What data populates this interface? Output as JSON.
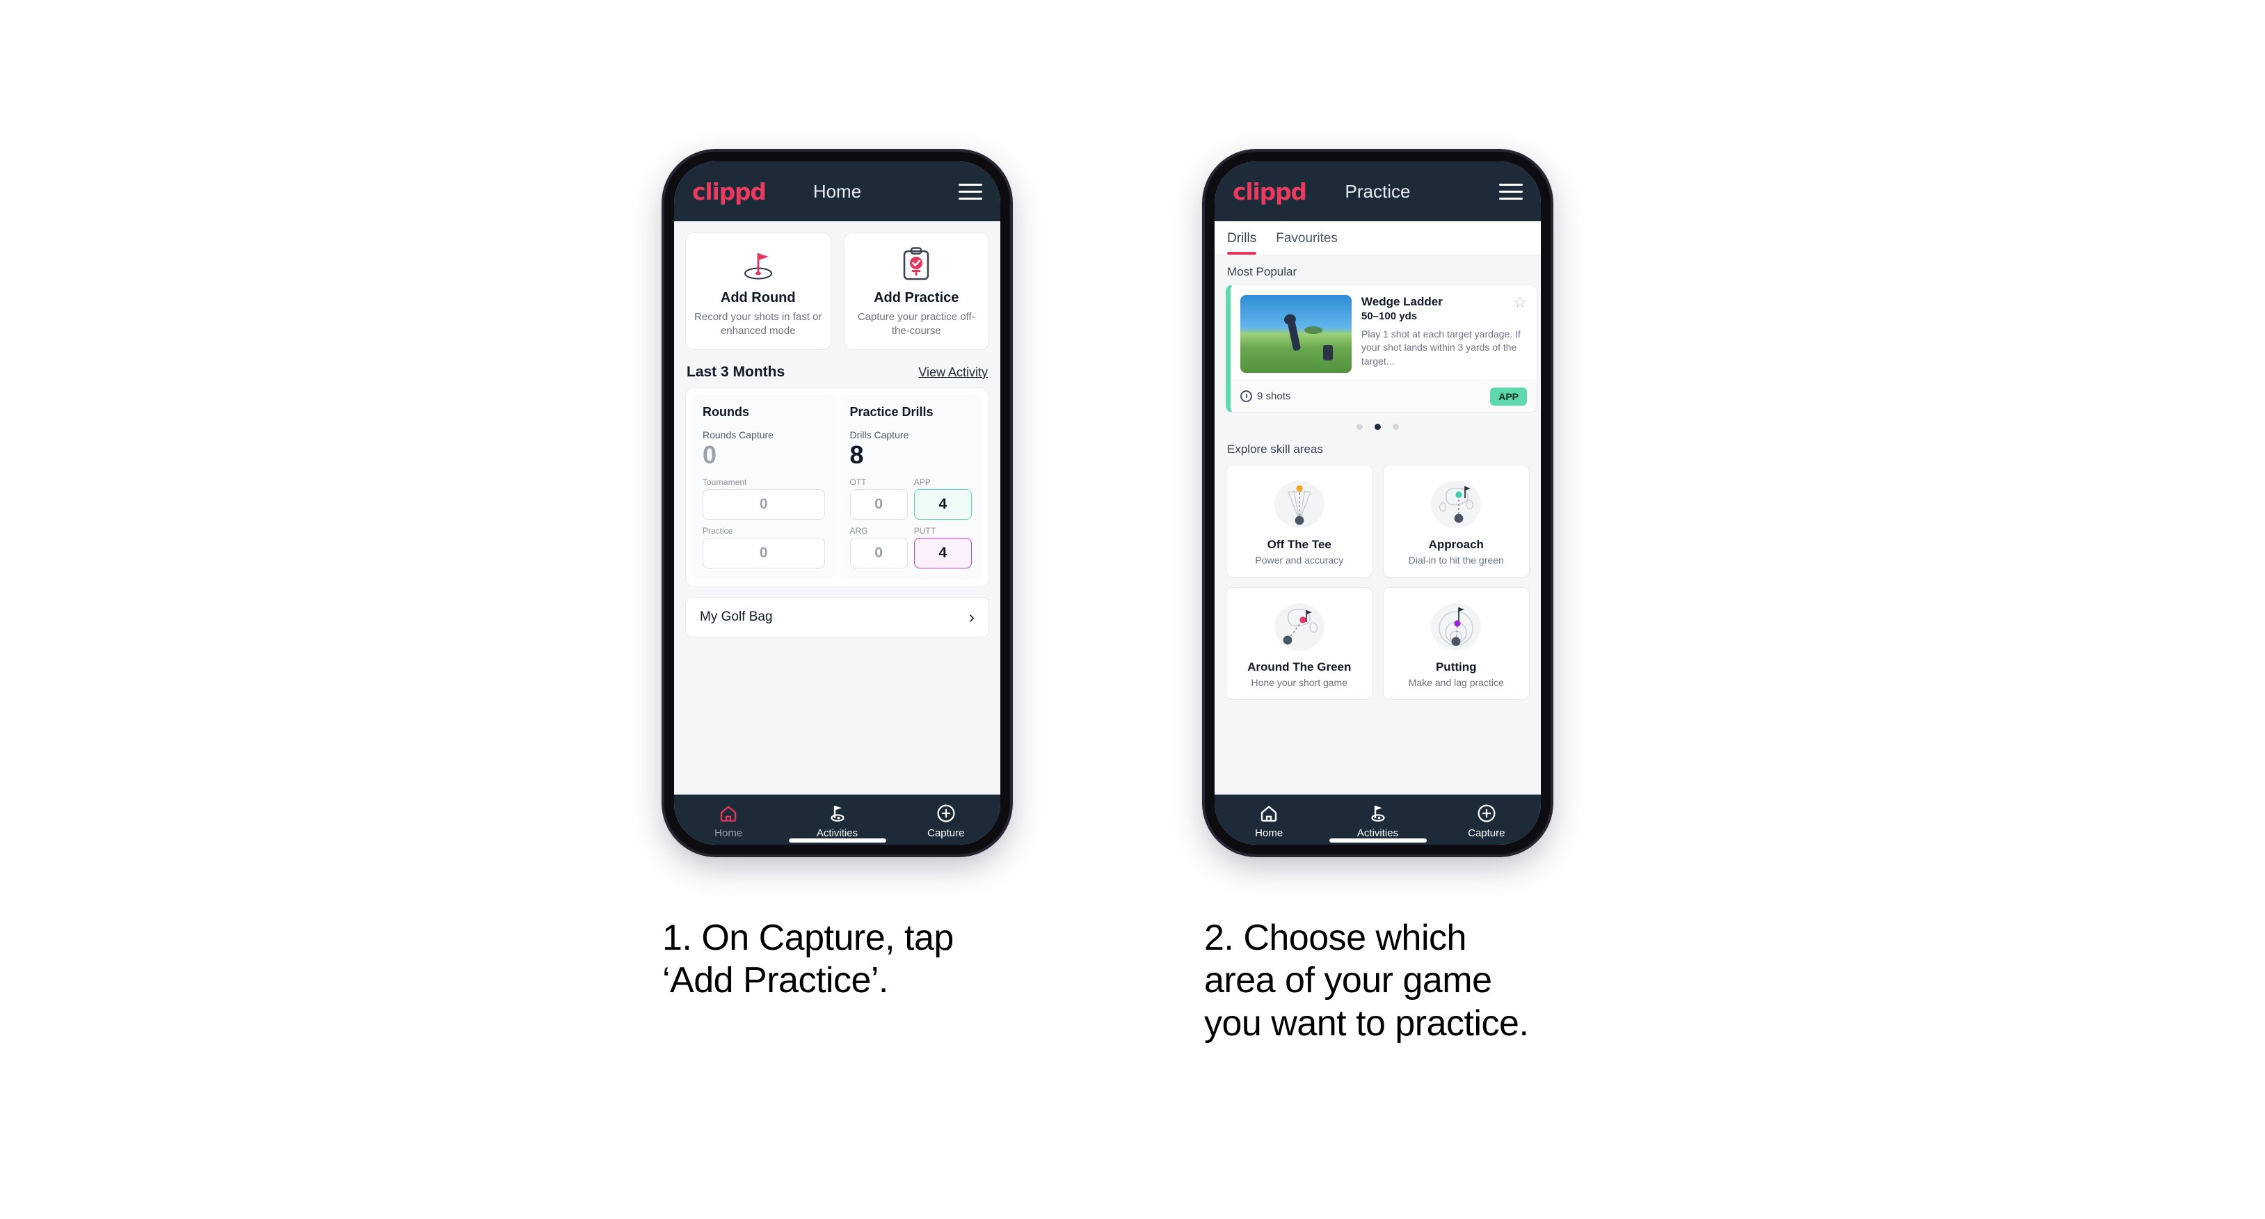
{
  "phones": [
    {
      "header": {
        "logo": "clippd",
        "title": "Home",
        "menu_icon": "hamburger-icon"
      },
      "actions": [
        {
          "icon": "golf-flag-hole-icon",
          "title": "Add Round",
          "desc": "Record your shots in fast or enhanced mode"
        },
        {
          "icon": "clipboard-check-icon",
          "title": "Add Practice",
          "desc": "Capture your practice off-the-course"
        }
      ],
      "section": {
        "title": "Last 3 Months",
        "link": "View Activity"
      },
      "stats": {
        "rounds": {
          "title": "Rounds",
          "capture_label": "Rounds Capture",
          "capture_value": "0",
          "fields": [
            {
              "label": "Tournament",
              "value": "0",
              "state": "empty"
            },
            {
              "label": "Practice",
              "value": "0",
              "state": "empty"
            }
          ]
        },
        "drills": {
          "title": "Practice Drills",
          "capture_label": "Drills Capture",
          "capture_value": "8",
          "fields": [
            {
              "label": "OTT",
              "value": "0",
              "state": "empty"
            },
            {
              "label": "APP",
              "value": "4",
              "state": "green"
            },
            {
              "label": "ARG",
              "value": "0",
              "state": "empty"
            },
            {
              "label": "PUTT",
              "value": "4",
              "state": "purple"
            }
          ]
        }
      },
      "golf_bag": {
        "label": "My Golf Bag",
        "chevron": "chevron-right-icon"
      },
      "nav": [
        {
          "icon": "home-icon",
          "label": "Home",
          "active": true
        },
        {
          "icon": "golf-flag-icon",
          "label": "Activities",
          "active": false
        },
        {
          "icon": "plus-circle-icon",
          "label": "Capture",
          "active": false
        }
      ]
    },
    {
      "header": {
        "logo": "clippd",
        "title": "Practice",
        "menu_icon": "hamburger-icon"
      },
      "tabs": [
        {
          "label": "Drills",
          "active": true
        },
        {
          "label": "Favourites",
          "active": false
        }
      ],
      "most_popular_label": "Most Popular",
      "drill": {
        "name": "Wedge Ladder",
        "yards": "50–100 yds",
        "description": "Play 1 shot at each target yardage. If your shot lands within 3 yards of the target...",
        "shots": "9 shots",
        "badge": "APP",
        "star_icon": "star-outline-icon",
        "accent": "#5ed9ae",
        "next_accent": "#a633e0"
      },
      "carousel_dots": {
        "count": 3,
        "active_index": 1
      },
      "skill_section_label": "Explore skill areas",
      "skills": [
        {
          "icon": "off-the-tee-icon",
          "title": "Off The Tee",
          "sub": "Power and accuracy",
          "dot_color": "#f5a623"
        },
        {
          "icon": "approach-icon",
          "title": "Approach",
          "sub": "Dial-in to hit the green",
          "dot_color": "#3ccfb0"
        },
        {
          "icon": "around-the-green-icon",
          "title": "Around The Green",
          "sub": "Hone your short game",
          "dot_color": "#e4355e"
        },
        {
          "icon": "putting-icon",
          "title": "Putting",
          "sub": "Make and lag practice",
          "dot_color": "#9b27d6"
        }
      ],
      "nav": [
        {
          "icon": "home-icon",
          "label": "Home",
          "active": false
        },
        {
          "icon": "golf-flag-icon",
          "label": "Activities",
          "active": false
        },
        {
          "icon": "plus-circle-icon",
          "label": "Capture",
          "active": false
        }
      ]
    }
  ],
  "captions": [
    {
      "text": "1. On Capture, tap\n‘Add Practice’."
    },
    {
      "text": "2. Choose which\narea of your game\nyou want to practice."
    }
  ],
  "colors": {
    "brand_pink": "#e4355e",
    "header_navy": "#1d2a38",
    "mint": "#5ed9ae",
    "purple": "#a633e0",
    "page_bg": "#ffffff"
  }
}
